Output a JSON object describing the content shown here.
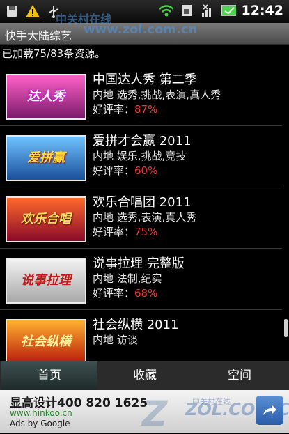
{
  "status_bar": {
    "time": "12:42",
    "icons": [
      "sd-card-icon",
      "warning-icon",
      "usb-icon",
      "wifi-signal-icon",
      "battery-charging-icon"
    ]
  },
  "app_bar": {
    "title": "快手大陆综艺"
  },
  "loaded_text": "已加载75/83条资源。",
  "watermark": {
    "top": "中关村在线",
    "top_url": "www.zol.com.cn",
    "bottom": "中关村在线",
    "bottom_zol": "ZOL.COM.CN"
  },
  "items": [
    {
      "title": "中国达人秀 第二季",
      "tags": "内地  选秀,挑战,表演,真人秀",
      "rating_label": "好评率：",
      "rating": "87%"
    },
    {
      "title": "爱拼才会赢 2011",
      "tags": "内地  娱乐,挑战,竞技",
      "rating_label": "好评率：",
      "rating": "60%"
    },
    {
      "title": "欢乐合唱团 2011",
      "tags": "内地  选秀,表演,真人秀",
      "rating_label": "好评率：",
      "rating": "75%"
    },
    {
      "title": "说事拉理 完整版",
      "tags": "内地  法制,纪实",
      "rating_label": "好评率：",
      "rating": "68%"
    },
    {
      "title": "社会纵横 2011",
      "tags": "内地  访谈",
      "rating_label": "",
      "rating": ""
    }
  ],
  "tabs": [
    {
      "label": "首页",
      "active": true
    },
    {
      "label": "收藏",
      "active": false
    },
    {
      "label": "空间",
      "active": false
    }
  ],
  "ad": {
    "title": "显高设计400 820 1625",
    "url": "www.hinkoo.cn",
    "by": "Ads by Google"
  },
  "colors": {
    "rating": "#ff3030",
    "tab_active": "#2f3f3f",
    "title_bar": "#5a5a5a"
  }
}
